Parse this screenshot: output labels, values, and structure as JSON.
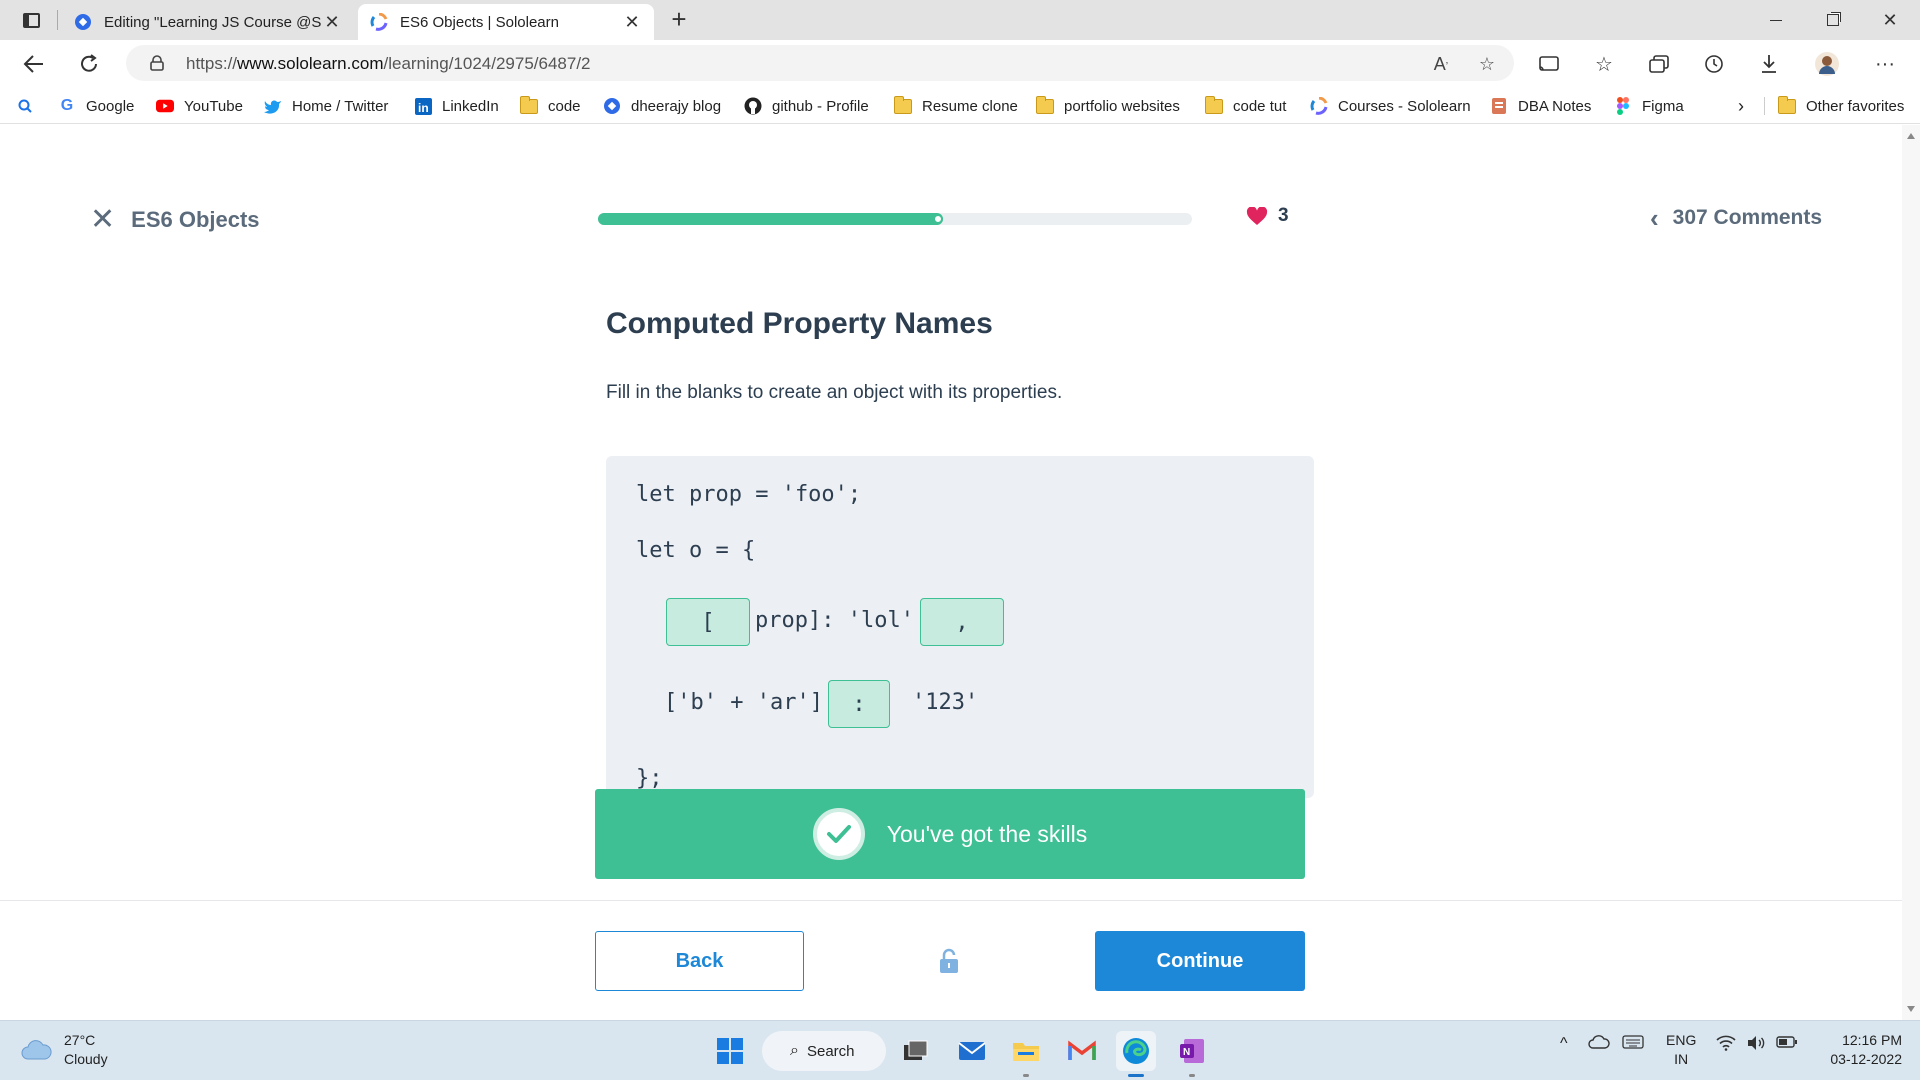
{
  "browser": {
    "tabs": [
      {
        "title": "Editing \"Learning JS Course @So",
        "active": false
      },
      {
        "title": "ES6 Objects | Sololearn",
        "active": true
      }
    ],
    "url_prefix": "https://",
    "url_domain": "www.sololearn.com",
    "url_path": "/learning/1024/2975/6487/2",
    "bookmarks": [
      {
        "label": "Google",
        "icon": "google-icon"
      },
      {
        "label": "YouTube",
        "icon": "youtube-icon"
      },
      {
        "label": "Home / Twitter",
        "icon": "twitter-icon"
      },
      {
        "label": "LinkedIn",
        "icon": "linkedin-icon"
      },
      {
        "label": "code",
        "icon": "folder-icon"
      },
      {
        "label": "dheerajy blog",
        "icon": "blog-icon"
      },
      {
        "label": "github - Profile",
        "icon": "github-icon"
      },
      {
        "label": "Resume clone",
        "icon": "folder-icon"
      },
      {
        "label": "portfolio websites",
        "icon": "folder-icon"
      },
      {
        "label": "code tut",
        "icon": "folder-icon"
      },
      {
        "label": "Courses - Sololearn",
        "icon": "sololearn-icon"
      },
      {
        "label": "DBA Notes",
        "icon": "notes-icon"
      },
      {
        "label": "Figma",
        "icon": "figma-icon"
      }
    ],
    "other_favorites": "Other favorites"
  },
  "lesson": {
    "course_title": "ES6 Objects",
    "progress": 0.58,
    "hearts": "3",
    "comments": "307 Comments",
    "title": "Computed Property Names",
    "instruction": "Fill in the blanks to create an object with its properties.",
    "code": {
      "line1": "let prop = 'foo';",
      "line2": "let o = {",
      "line3_mid": "prop]: 'lol'",
      "line4_pre": "['b' + 'ar']",
      "line4_post": "'123'",
      "line5": "};"
    },
    "blanks": {
      "blank1": "[",
      "blank2": ",",
      "blank3": ":"
    },
    "feedback": "You've got the skills",
    "back_label": "Back",
    "continue_label": "Continue"
  },
  "taskbar": {
    "temperature": "27°C",
    "weather": "Cloudy",
    "search_label": "Search",
    "lang_top": "ENG",
    "lang_bottom": "IN",
    "time": "12:16 PM",
    "date": "03-12-2022"
  },
  "colors": {
    "accent_green": "#3fbf94",
    "accent_blue": "#1e88d8",
    "heart_red": "#e0245e"
  }
}
